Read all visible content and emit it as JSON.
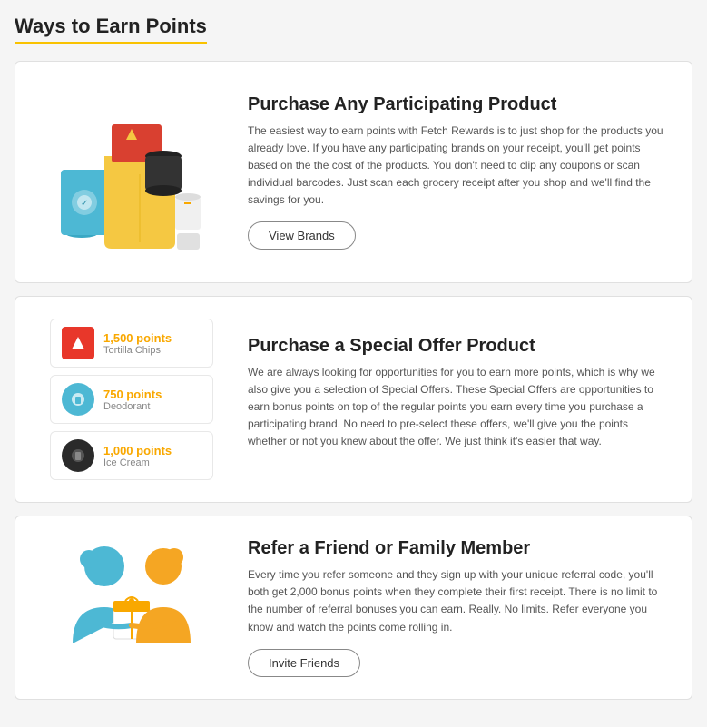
{
  "page": {
    "title": "Ways to Earn Points"
  },
  "cards": [
    {
      "id": "purchase-product",
      "title": "Purchase Any Participating Product",
      "description": "The easiest way to earn points with Fetch Rewards is to just shop for the products you already love. If you have any participating brands on your receipt, you'll get points based on the the cost of the products. You don't need to clip any coupons or scan individual barcodes. Just scan each grocery receipt after you shop and we'll find the savings for you.",
      "button_label": "View Brands"
    },
    {
      "id": "special-offer",
      "title": "Purchase a Special Offer Product",
      "description": "We are always looking for opportunities for you to earn more points, which is why we also give you a selection of Special Offers. These Special Offers are opportunities to earn bonus points on top of the regular points you earn every time you purchase a participating brand. No need to pre-select these offers, we'll give you the points whether or not you knew about the offer. We just think it's easier that way.",
      "button_label": null,
      "offers": [
        {
          "points": "1,500 points",
          "product": "Tortilla Chips",
          "icon_color": "red"
        },
        {
          "points": "750 points",
          "product": "Deodorant",
          "icon_color": "blue"
        },
        {
          "points": "1,000 points",
          "product": "Ice Cream",
          "icon_color": "dark"
        }
      ]
    },
    {
      "id": "refer-friend",
      "title": "Refer a Friend or Family Member",
      "description": "Every time you refer someone and they sign up with your unique referral code, you'll both get 2,000 bonus points when they complete their first receipt. There is no limit to the number of referral bonuses you can earn. Really. No limits. Refer everyone you know and watch the points come rolling in.",
      "button_label": "Invite Friends"
    }
  ]
}
